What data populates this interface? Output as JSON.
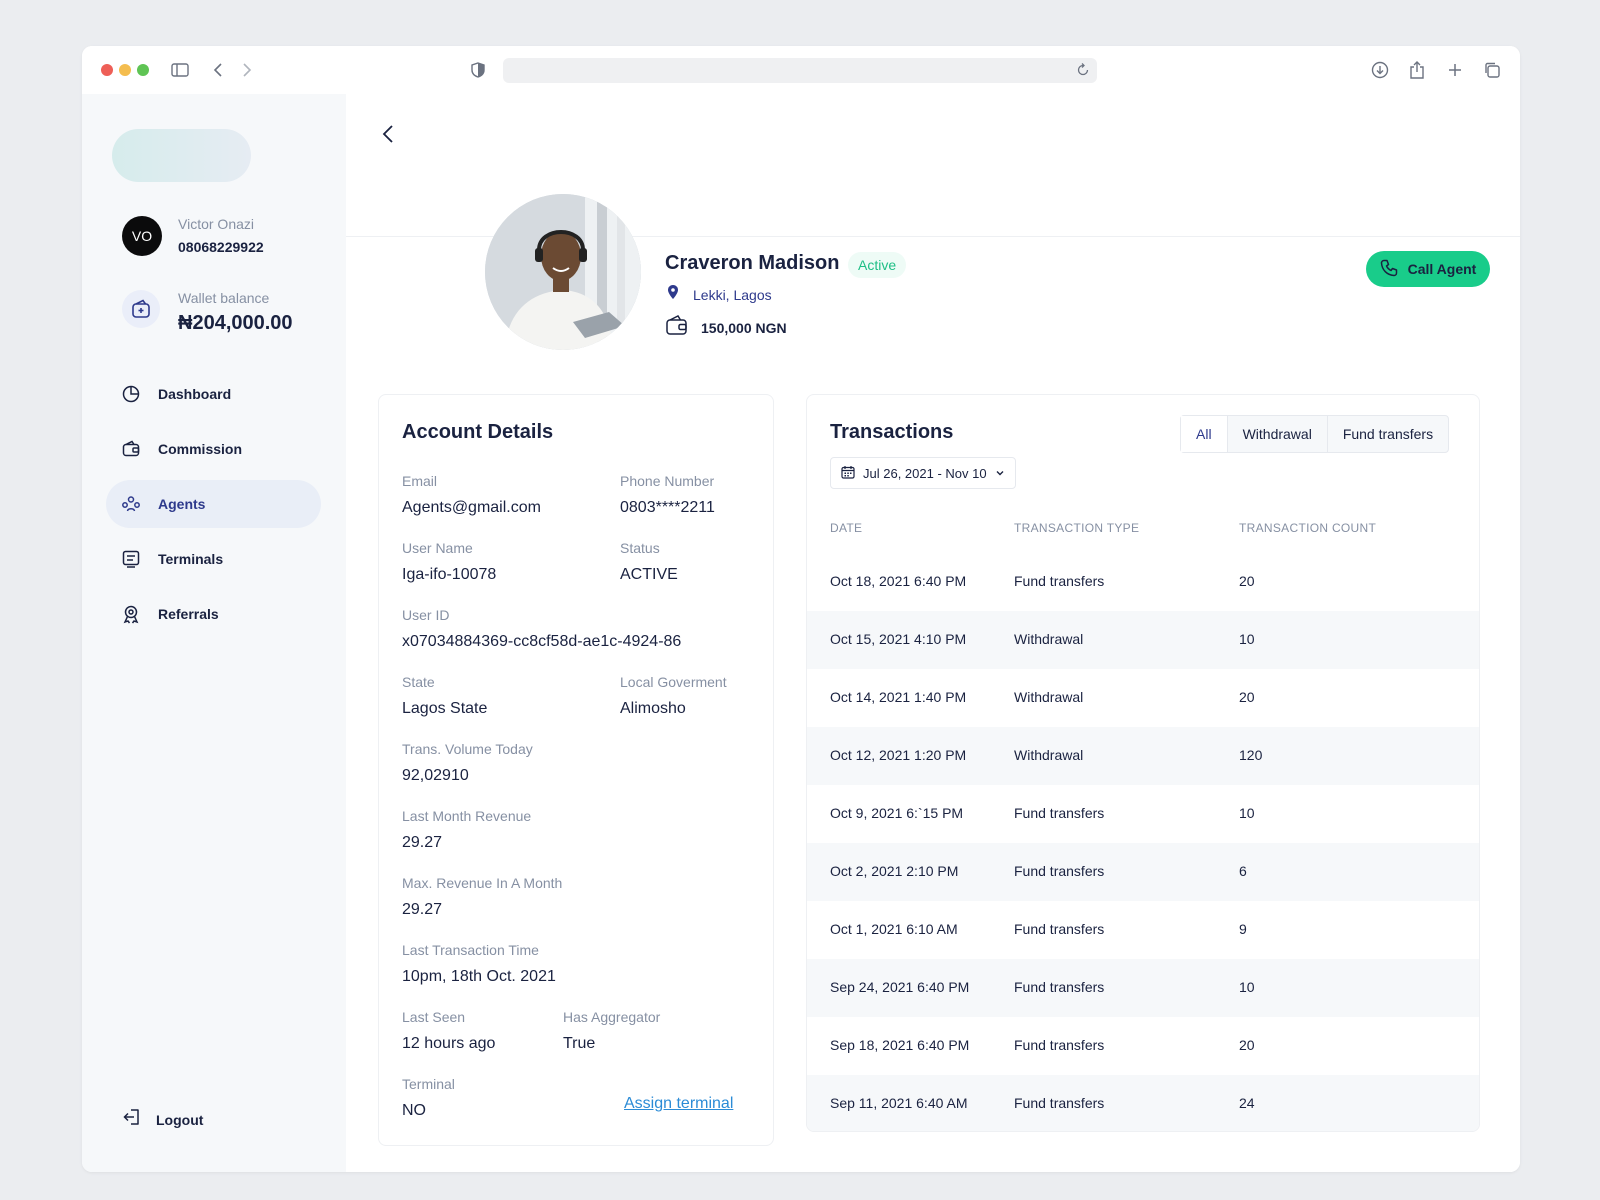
{
  "browser": {
    "url": "",
    "icons": [
      "sidebar-toggle-icon",
      "back-arrow-icon",
      "forward-arrow-icon",
      "shield-icon",
      "reload-icon",
      "download-icon",
      "share-icon",
      "new-tab-icon",
      "tabs-overview-icon"
    ]
  },
  "sidebar": {
    "user": {
      "initials": "VO",
      "name": "Victor Onazi",
      "phone": "08068229922"
    },
    "wallet": {
      "label": "Wallet balance",
      "value": "₦204,000.00"
    },
    "nav": [
      {
        "label": "Dashboard",
        "icon": "pie-chart-icon"
      },
      {
        "label": "Commission",
        "icon": "wallet-icon"
      },
      {
        "label": "Agents",
        "icon": "people-icon",
        "active": true
      },
      {
        "label": "Terminals",
        "icon": "terminal-icon"
      },
      {
        "label": "Referrals",
        "icon": "badge-icon"
      }
    ],
    "logout_label": "Logout"
  },
  "profile": {
    "name": "Craveron Madison",
    "status": "Active",
    "location": "Lekki, Lagos",
    "balance": "150,000 NGN",
    "call_label": "Call Agent"
  },
  "account": {
    "title": "Account Details",
    "email_label": "Email",
    "email": "Agents@gmail.com",
    "phone_label": "Phone Number",
    "phone": "0803****2211",
    "username_label": "User Name",
    "username": "Iga-ifo-10078",
    "status_label": "Status",
    "status": "ACTIVE",
    "userid_label": "User ID",
    "userid": "x07034884369-cc8cf58d-ae1c-4924-86",
    "state_label": "State",
    "state": "Lagos State",
    "lga_label": "Local Goverment",
    "lga": "Alimosho",
    "volume_label": "Trans. Volume Today",
    "volume": "92,02910",
    "lastmonth_label": "Last Month Revenue",
    "lastmonth": "29.27",
    "maxrev_label": "Max. Revenue In A Month",
    "maxrev": "29.27",
    "lasttx_label": "Last Transaction Time",
    "lasttx": "10pm, 18th Oct. 2021",
    "lastseen_label": "Last Seen",
    "lastseen": "12 hours ago",
    "aggregator_label": "Has Aggregator",
    "aggregator": "True",
    "terminal_label": "Terminal",
    "terminal": "NO",
    "assign_label": "Assign terminal"
  },
  "transactions": {
    "title": "Transactions",
    "tabs": [
      "All",
      "Withdrawal",
      "Fund transfers"
    ],
    "active_tab": "All",
    "date_range": "Jul 26, 2021 - Nov 10",
    "columns": [
      "DATE",
      "TRANSACTION TYPE",
      "TRANSACTION COUNT"
    ],
    "rows": [
      {
        "date": "Oct 18, 2021 6:40 PM",
        "type": "Fund transfers",
        "count": "20"
      },
      {
        "date": "Oct 15, 2021 4:10 PM",
        "type": "Withdrawal",
        "count": "10"
      },
      {
        "date": "Oct 14, 2021 1:40 PM",
        "type": "Withdrawal",
        "count": "20"
      },
      {
        "date": "Oct 12, 2021 1:20 PM",
        "type": "Withdrawal",
        "count": "120"
      },
      {
        "date": "Oct 9, 2021 6:`15 PM",
        "type": "Fund transfers",
        "count": "10"
      },
      {
        "date": "Oct 2, 2021 2:10 PM",
        "type": "Fund transfers",
        "count": "6"
      },
      {
        "date": "Oct 1, 2021 6:10 AM",
        "type": "Fund transfers",
        "count": "9"
      },
      {
        "date": "Sep 24, 2021 6:40 PM",
        "type": "Fund transfers",
        "count": "10"
      },
      {
        "date": "Sep 18, 2021 6:40 PM",
        "type": "Fund transfers",
        "count": "20"
      },
      {
        "date": "Sep 11, 2021 6:40 AM",
        "type": "Fund transfers",
        "count": "24"
      }
    ]
  },
  "colors": {
    "accent": "#19cc8a",
    "primary": "#2e3a8c",
    "link": "#2b8bd6",
    "sidebar_bg": "#f6f8fa"
  }
}
